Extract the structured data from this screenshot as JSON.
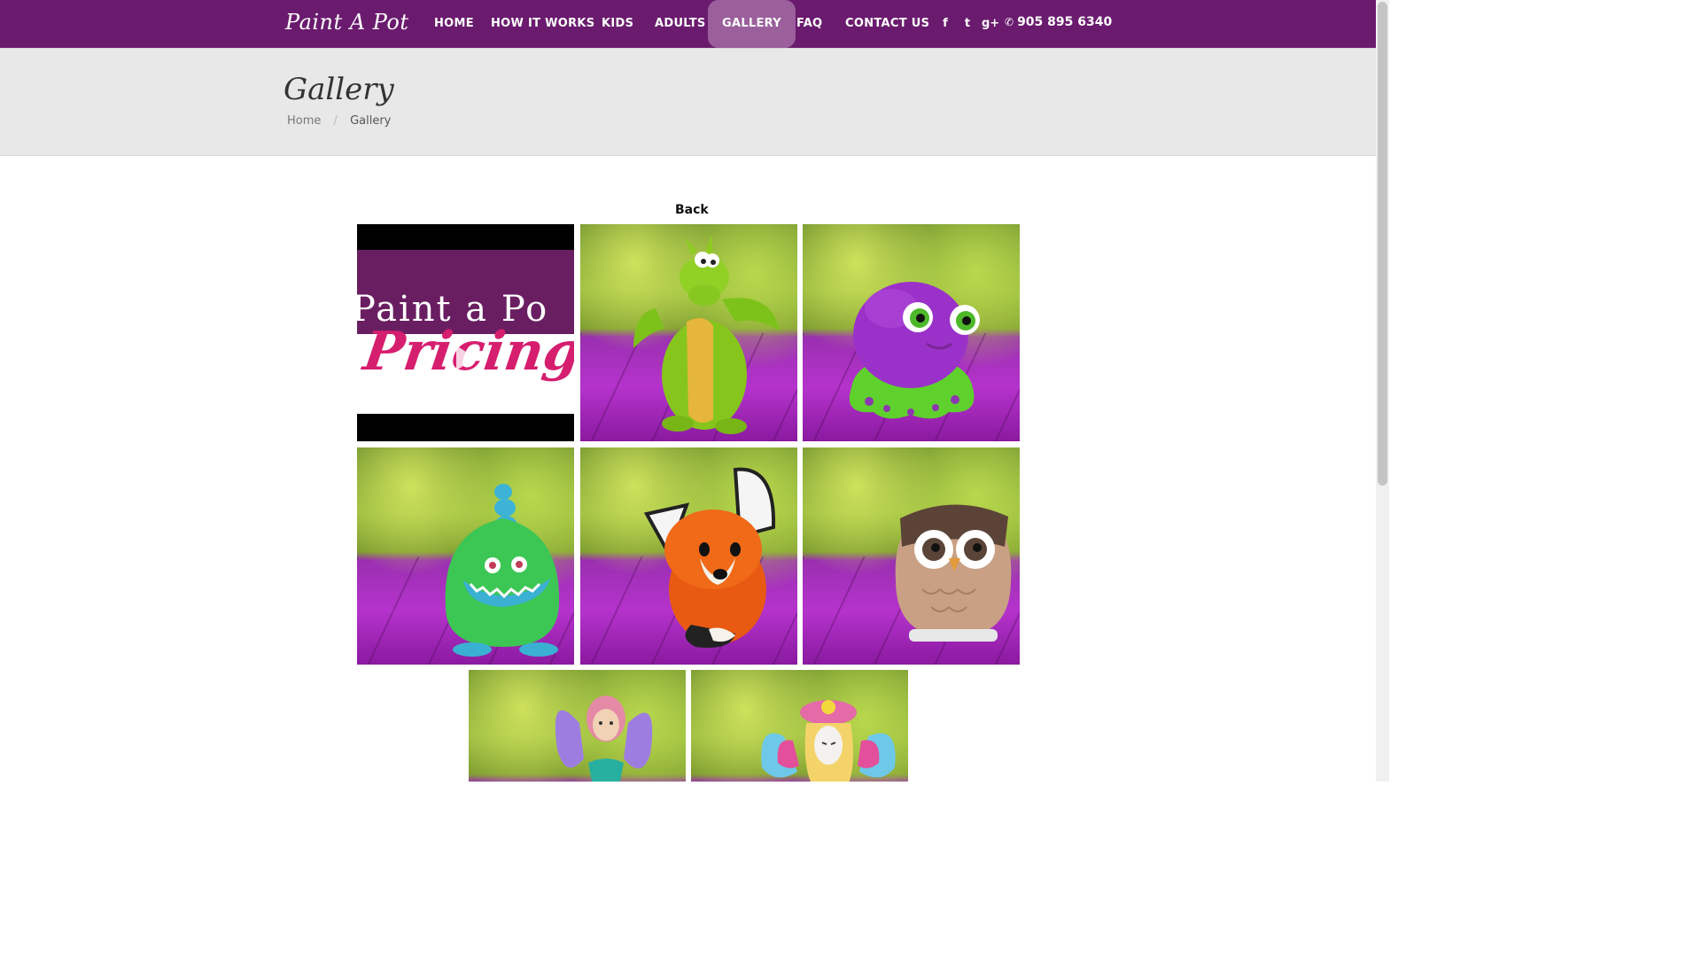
{
  "nav": {
    "brand": "Paint A Pot",
    "items": [
      {
        "label": "HOME"
      },
      {
        "label": "HOW IT WORKS"
      },
      {
        "label": "KIDS"
      },
      {
        "label": "ADULTS"
      },
      {
        "label": "GALLERY",
        "active": true
      },
      {
        "label": "FAQ"
      },
      {
        "label": "CONTACT US"
      }
    ],
    "social": [
      {
        "icon": "facebook-icon",
        "glyph": "f"
      },
      {
        "icon": "twitter-icon",
        "glyph": "t"
      },
      {
        "icon": "google-plus-icon",
        "glyph": "g+"
      }
    ],
    "phone": "905 895 6340",
    "phone_icon": "✆"
  },
  "header": {
    "title": "Gallery",
    "breadcrumb": [
      "Home",
      "Gallery"
    ],
    "breadcrumb_sep": "/"
  },
  "gallery": {
    "back_label": "Back",
    "video": {
      "title": "Paint a Po",
      "subtitle": "Pricing"
    },
    "items": [
      {
        "subject": "dragon"
      },
      {
        "subject": "octopus"
      },
      {
        "subject": "monster"
      },
      {
        "subject": "fox"
      },
      {
        "subject": "owl"
      },
      {
        "subject": "fairy"
      },
      {
        "subject": "butterfly-fairy"
      }
    ]
  },
  "colors": {
    "nav_bg": "#6a1b6e",
    "nav_active": "#9b5f9c",
    "header_bg": "#e8e8e8"
  }
}
